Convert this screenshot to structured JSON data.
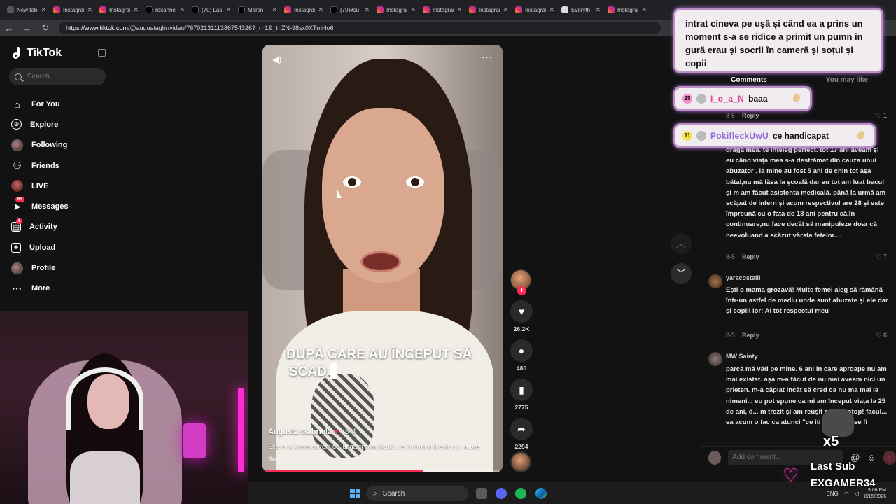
{
  "browser": {
    "tabs": [
      {
        "label": "New tab",
        "icon": "plain"
      },
      {
        "label": "Instagram",
        "icon": "insta"
      },
      {
        "label": "Instagram",
        "icon": "insta"
      },
      {
        "label": "roxanne",
        "icon": "tiktok"
      },
      {
        "label": "(70) Las",
        "icon": "tiktok"
      },
      {
        "label": "Martin",
        "icon": "tiktok"
      },
      {
        "label": "Instagram",
        "icon": "insta"
      },
      {
        "label": "(70)#su",
        "icon": "tiktok"
      },
      {
        "label": "Instagram",
        "icon": "insta"
      },
      {
        "label": "Instagram",
        "icon": "insta"
      },
      {
        "label": "Instagram",
        "icon": "insta"
      },
      {
        "label": "Instagram",
        "icon": "insta"
      },
      {
        "label": "Everyth",
        "icon": "doc"
      },
      {
        "label": "Instagram",
        "icon": "insta"
      }
    ],
    "url_host": "https://www.tiktok.com",
    "url_path": "/@augustagbr/video/7670213111386754326?_r=1&_t=ZN-98sx0XTmHo6"
  },
  "nav": {
    "logo": "TikTok",
    "search_placeholder": "Search",
    "items": [
      {
        "label": "For You",
        "icon": "home-icon",
        "glyph": "⌂"
      },
      {
        "label": "Explore",
        "icon": "compass-icon",
        "glyph": "⊘"
      },
      {
        "label": "Following",
        "icon": "following-avatar-icon",
        "glyph": ""
      },
      {
        "label": "Friends",
        "icon": "friends-icon",
        "glyph": "⚇"
      },
      {
        "label": "LIVE",
        "icon": "live-avatar-icon",
        "glyph": ""
      },
      {
        "label": "Messages",
        "icon": "messages-icon",
        "glyph": "➤",
        "badge": "65"
      },
      {
        "label": "Activity",
        "icon": "activity-icon",
        "glyph": "▤",
        "badge": "6"
      },
      {
        "label": "Upload",
        "icon": "upload-icon",
        "glyph": "+"
      },
      {
        "label": "Profile",
        "icon": "profile-avatar-icon",
        "glyph": ""
      },
      {
        "label": "More",
        "icon": "more-icon",
        "glyph": "···"
      }
    ]
  },
  "video": {
    "caption_line1": "DUPĂ CARE AU ÎNCEPUT SĂ",
    "caption_line2": "SCAD",
    "author": "Augusta Gabriela",
    "date": "8-4",
    "description": "Este o poveste extrem de lungă și complicată, ce va transmit este ca",
    "more": "more",
    "see_translation": "See translation",
    "progress": 0.67
  },
  "actions": {
    "likes": "26.2K",
    "comments": "480",
    "saves": "2775",
    "shares": "2294"
  },
  "comments_panel": {
    "tab_comments": "Comments",
    "tab_you_may_like": "You may like",
    "reply_label": "Reply",
    "items": [
      {
        "date": "8-5",
        "likes": "1"
      },
      {
        "author": "",
        "date": "8-5",
        "likes": "7",
        "text": "draga mea. te înțeleg perfect. tot 17 ani aveam și eu când viața mea s-a destrămat din cauza unui abuzator . la mine au fost 5 ani de chin tot așa bătai,nu mă lăsa la școală dar eu tot am luat bacul și m am făcut asistenta medicală. până la urmă am scăpat de infern și acum respectivul are 28 și este împreună cu o fata de 18 ani pentru că,în continuare,nu face decât să manipuleze doar că neevoluand a scăzut vârsta fetelor...."
      },
      {
        "author": "yaracostalll",
        "date": "8-5",
        "likes": "6",
        "text": "Ești o mama grozavă! Multe femei aleg să rămână într-un astfel de mediu unde sunt abuzate și ele dar și copiii lor! Ai tot respectul meu"
      },
      {
        "author": "MW Sainty",
        "text": "parcă mă văd pe mine. 6 ani în care aproape nu am mai existat. așa m-a făcut de nu mai aveam nici un prieten. m-a căpiat încât să cred ca nu ma mai ia nimeni... eu pot spune ca mi am început viața la 25 de ani, d... m trezit și am reușit sa pun stop! facul... ea acum o fac ca atunci \"ce iti trebuie ... se fi"
      }
    ],
    "add_placeholder": "Add comment..."
  },
  "stream_overlay": {
    "chat_big": "intrat cineva pe ușă și când ea a prins un moment s-a se ridice a primit un pumn în gură erau și socrii în cameră și soțul și copii",
    "chat1": {
      "badge": "25",
      "badge_color": "#f78fd0",
      "name": "I_o_a_N",
      "name_color": "#e0438f",
      "message": "baaa"
    },
    "chat2": {
      "badge": "11",
      "badge_color": "#f5e34b",
      "name": "PokifleckUwU",
      "name_color": "#8f69d8",
      "message": "ce handicapat"
    },
    "x5": "x5",
    "last_sub_label": "Last Sub",
    "last_sub_name": "EXGAMER34"
  },
  "taskbar": {
    "search": "Search",
    "lang": "ENG",
    "time": "9:06 PM",
    "date": "8/15/2026"
  },
  "colors": {
    "accent": "#fe2c55",
    "chat_border": "#b98fc4"
  }
}
